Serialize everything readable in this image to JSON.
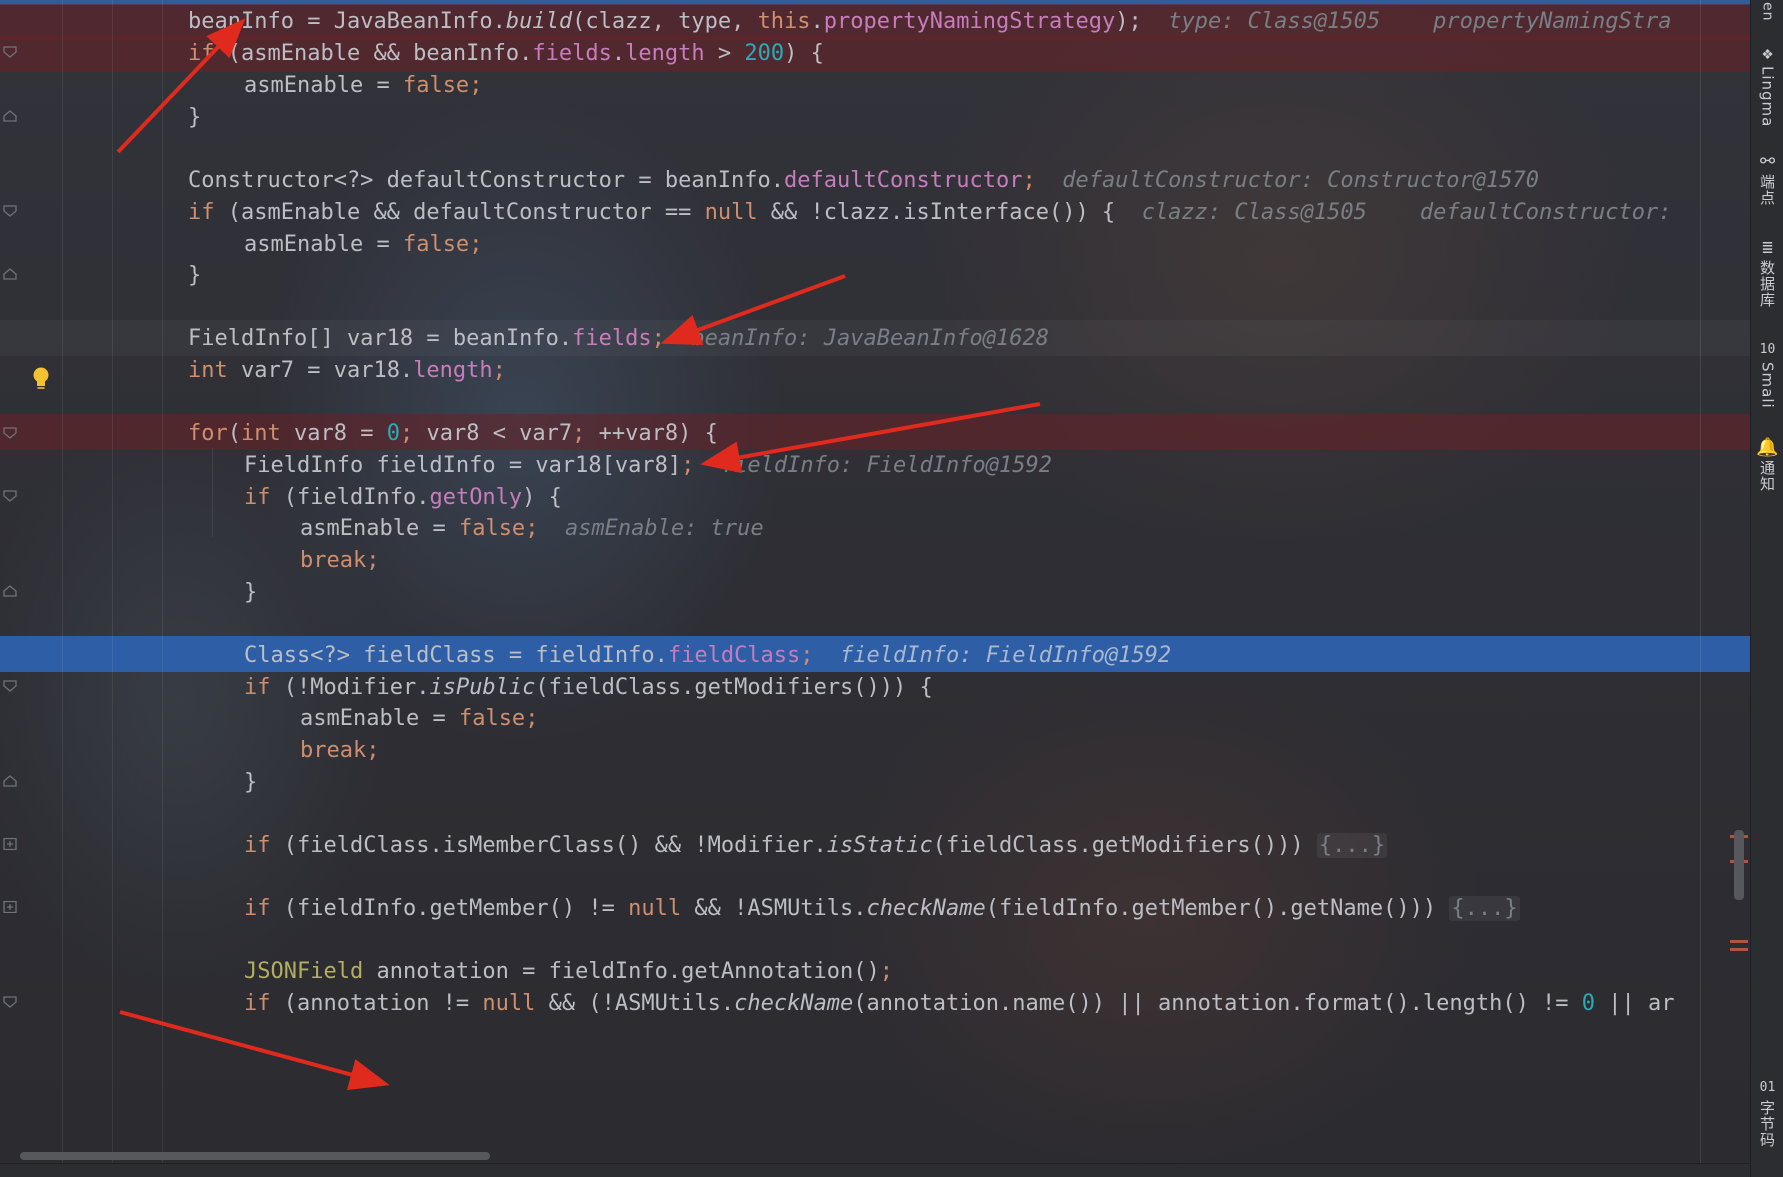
{
  "code": {
    "line01": {
      "beanInfo_lhs": "beanInfo",
      "eq": " = JavaBeanInfo.",
      "build": "build",
      "args1": "(clazz, type, ",
      "this": "this",
      "dot": ".",
      "pns": "propertyNamingStrategy",
      "end": ");",
      "hint": "type: Class@1505    propertyNamingStra"
    },
    "line02": {
      "if": "if",
      "a": " (asmEnable && beanInfo.",
      "fields": "fields",
      "dot": ".",
      "length": "length",
      "b": " > ",
      "num": "200",
      "c": ") {"
    },
    "line03": {
      "a": "asmEnable = ",
      "false": "false",
      "semi": ";"
    },
    "line04": {
      "brace": "}"
    },
    "line06": {
      "a": "Constructor<?> defaultConstructor = beanInfo.",
      "fld": "defaultConstructor",
      "semi": ";",
      "hint": "defaultConstructor: Constructor@1570"
    },
    "line07": {
      "if": "if",
      "a": " (asmEnable && defaultConstructor == ",
      "null": "null",
      "b": " && !clazz.isInterface()) {",
      "hint": "clazz: Class@1505    defaultConstructor:"
    },
    "line08": {
      "a": "asmEnable = ",
      "false": "false",
      "semi": ";"
    },
    "line09": {
      "brace": "}"
    },
    "line11": {
      "a": "FieldInfo[] var18 = beanInfo.",
      "fld": "fields",
      "semi": ";",
      "hint": "beanInfo: JavaBeanInfo@1628"
    },
    "line12": {
      "int": "int",
      "a": " var7 = var18.",
      "fld": "length",
      "semi": ";"
    },
    "line14": {
      "for": "for",
      "p": "(",
      "int": "int",
      "a": " var8 = ",
      "zero": "0",
      "s1": ";",
      "b": " var8 < var7",
      "s2": ";",
      "c": " ++var8) {"
    },
    "line15": {
      "a": "FieldInfo fieldInfo = var18[var8]",
      "semi": ";",
      "hint": "fieldInfo: FieldInfo@1592"
    },
    "line16": {
      "if": "if",
      "a": " (fieldInfo.",
      "fld": "getOnly",
      "b": ") {"
    },
    "line17": {
      "a": "asmEnable = ",
      "false": "false",
      "semi": ";",
      "hint": "asmEnable: true"
    },
    "line18": {
      "break": "break",
      "semi": ";"
    },
    "line19": {
      "brace": "}"
    },
    "line21": {
      "a": "Class<?> fieldClass = fieldInfo.",
      "fld": "fieldClass",
      "semi": ";",
      "hint": "fieldInfo: FieldInfo@1592"
    },
    "line22": {
      "if": "if",
      "a": " (!Modifier.",
      "m": "isPublic",
      "b": "(fieldClass.getModifiers())) {"
    },
    "line23": {
      "a": "asmEnable = ",
      "false": "false",
      "semi": ";"
    },
    "line24": {
      "break": "break",
      "semi": ";"
    },
    "line25": {
      "brace": "}"
    },
    "line27": {
      "if": "if",
      "a": " (fieldClass.isMemberClass() && !Modifier.",
      "m": "isStatic",
      "b": "(fieldClass.getModifiers())) ",
      "fold": "{...}"
    },
    "line29": {
      "if": "if",
      "a": " (fieldInfo.getMember() != ",
      "null": "null",
      "b": " && !ASMUtils.",
      "m": "checkName",
      "c": "(fieldInfo.getMember().getName())) ",
      "fold": "{...}"
    },
    "line31": {
      "ann": "JSONField",
      "a": " annotation = fieldInfo.getAnnotation()",
      "semi": ";"
    },
    "line32": {
      "if": "if",
      "a": " (annotation != ",
      "null": "null",
      "b": " && (!ASMUtils.",
      "m": "checkName",
      "c": "(annotation.name()) || annotation.format().length() != ",
      "zero": "0",
      "d": " || ar"
    }
  },
  "tool_window_bar": [
    {
      "icon": "lingma-icon",
      "label": "Lingma"
    },
    {
      "icon": "endpoints-icon",
      "label": "端点"
    },
    {
      "icon": "database-icon",
      "label": "数据库"
    },
    {
      "icon": "smali-icon",
      "label": "Smali"
    },
    {
      "icon": "notifications-icon",
      "label": "通知"
    },
    {
      "icon": "bytecode-icon",
      "label": "字节码"
    }
  ],
  "right_bar_top_fragment": "en",
  "colors": {
    "keyword": "#cf8e6d",
    "field": "#c77dbb",
    "number": "#2aacb8",
    "annotation": "#b3ae60",
    "hint": "#7a7e85",
    "default_text": "#bcbec4",
    "breakpoint_row": "#69202680",
    "execution_row": "#2d5ea6",
    "arrow": "#e02a1e"
  }
}
